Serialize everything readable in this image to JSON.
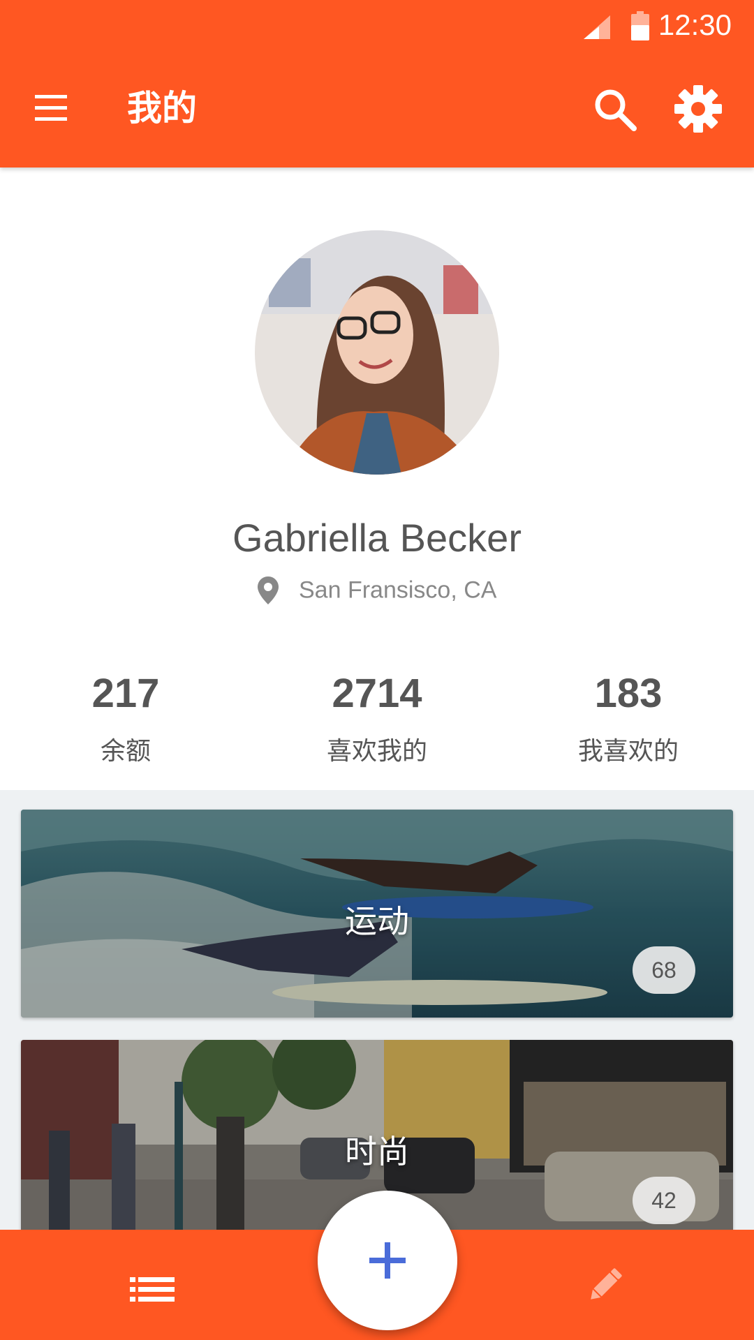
{
  "status_bar": {
    "time": "12:30",
    "icons": [
      "signal-icon",
      "battery-icon"
    ]
  },
  "app_bar": {
    "title": "我的",
    "icons": [
      "menu-icon",
      "search-icon",
      "settings-icon"
    ]
  },
  "profile": {
    "name": "Gabriella Becker",
    "location": "San Fransisco, CA",
    "stats": [
      {
        "value": "217",
        "label": "余额"
      },
      {
        "value": "2714",
        "label": "喜欢我的"
      },
      {
        "value": "183",
        "label": "我喜欢的"
      }
    ]
  },
  "cards": [
    {
      "title": "运动",
      "count": "68"
    },
    {
      "title": "时尚",
      "count": "42"
    }
  ],
  "bottom_bar": {
    "icons": [
      "list-icon",
      "add-icon",
      "edit-icon"
    ]
  },
  "colors": {
    "primary": "#FF5722",
    "accent": "#4A6CD9",
    "background": "#EEF1F3"
  }
}
